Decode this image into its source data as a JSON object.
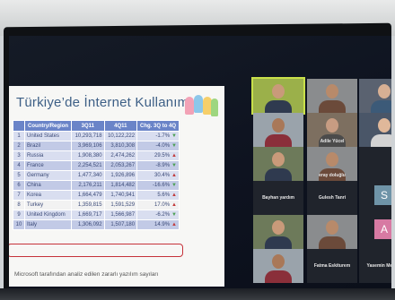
{
  "slide": {
    "title": "Türkiye’de İnternet Kullanımı",
    "headers": [
      "",
      "Country/Region",
      "3Q11",
      "4Q11",
      "Chg. 3Q to 4Q"
    ],
    "rows": [
      {
        "rank": "1",
        "country": "United States",
        "q3": "10,293,718",
        "q4": "10,122,222",
        "chg": "-1.7%",
        "dir": "▼"
      },
      {
        "rank": "2",
        "country": "Brazil",
        "q3": "3,969,106",
        "q4": "3,810,308",
        "chg": "-4.0%",
        "dir": "▼"
      },
      {
        "rank": "3",
        "country": "Russia",
        "q3": "1,908,380",
        "q4": "2,474,262",
        "chg": "29.5%",
        "dir": "▲"
      },
      {
        "rank": "4",
        "country": "France",
        "q3": "2,254,521",
        "q4": "2,053,267",
        "chg": "-8.9%",
        "dir": "▼"
      },
      {
        "rank": "5",
        "country": "Germany",
        "q3": "1,477,340",
        "q4": "1,926,896",
        "chg": "30.4%",
        "dir": "▲"
      },
      {
        "rank": "6",
        "country": "China",
        "q3": "2,176,211",
        "q4": "1,814,482",
        "chg": "-16.6%",
        "dir": "▼"
      },
      {
        "rank": "7",
        "country": "Korea",
        "q3": "1,664,479",
        "q4": "1,740,941",
        "chg": "5.6%",
        "dir": "▲"
      },
      {
        "rank": "8",
        "country": "Turkey",
        "q3": "1,359,815",
        "q4": "1,591,529",
        "chg": "17.0%",
        "dir": "▲"
      },
      {
        "rank": "9",
        "country": "United Kingdom",
        "q3": "1,669,717",
        "q4": "1,566,987",
        "chg": "-6.2%",
        "dir": "▼"
      },
      {
        "rank": "10",
        "country": "Italy",
        "q3": "1,306,092",
        "q4": "1,507,180",
        "chg": "14.9%",
        "dir": "▲"
      }
    ],
    "footnote": "Microsoft tarafından analiz edilen zararlı yazılım sayıları"
  },
  "participants": [
    {
      "name": "",
      "kind": "video",
      "active": true
    },
    {
      "name": "",
      "kind": "video"
    },
    {
      "name": "",
      "kind": "video"
    },
    {
      "name": "",
      "kind": "video"
    },
    {
      "name": "Adile Yücel",
      "kind": "video"
    },
    {
      "name": "",
      "kind": "video"
    },
    {
      "name": "",
      "kind": "video"
    },
    {
      "name": "eray doluğlu",
      "kind": "video"
    },
    {
      "name": "",
      "kind": "empty"
    },
    {
      "name": "Bayhan yardım",
      "kind": "empty"
    },
    {
      "name": "Gulesh Tanri",
      "kind": "empty"
    },
    {
      "name": "",
      "kind": "avatar",
      "letter": "S",
      "color": "#6f94a8"
    },
    {
      "name": "",
      "kind": "video"
    },
    {
      "name": "",
      "kind": "video"
    },
    {
      "name": "",
      "kind": "avatar",
      "letter": "A",
      "color": "#d77aa3"
    },
    {
      "name": "",
      "kind": "video"
    },
    {
      "name": "Fatma Eskiturem",
      "kind": "empty"
    },
    {
      "name": "Yasemin Memen",
      "kind": "empty"
    }
  ],
  "colors": {
    "table_header": "#6a84c8",
    "highlight_border": "#c6323a",
    "active_speaker": "#c9e04a"
  }
}
